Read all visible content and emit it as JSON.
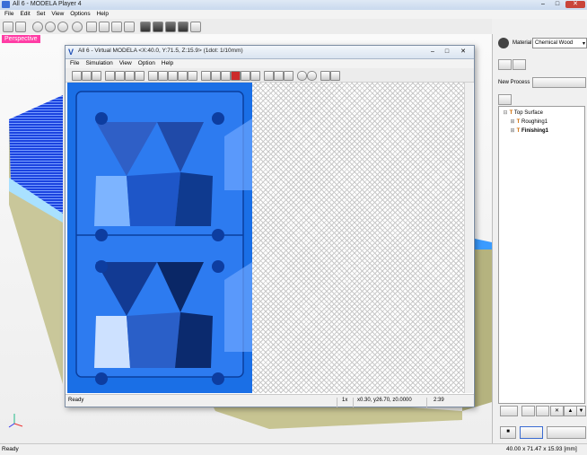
{
  "app": {
    "title": "All 6 - MODELA Player 4",
    "min_label": "–",
    "max_label": "□",
    "close_label": "✕"
  },
  "menu": [
    "File",
    "Edit",
    "Set",
    "View",
    "Options",
    "Help"
  ],
  "viewport": {
    "mode_label": "Perspective"
  },
  "right_panel": {
    "material_label": "Material",
    "material_value": "Chemical Wood",
    "new_process_label": "New Process",
    "tree": [
      {
        "label": "Top Surface",
        "level": 0,
        "expander": "⊟"
      },
      {
        "label": "Roughing1",
        "level": 1,
        "expander": "⊞"
      },
      {
        "label": "Finishing1",
        "level": 1,
        "expander": "⊞"
      }
    ]
  },
  "status_bar": {
    "left": "Ready",
    "right": "40.00 x 71.47 x 15.93 [mm]"
  },
  "virtual_modela": {
    "title": "All 6 - Virtual MODELA <X:40.0, Y:71.5, Z:15.9> (1dot: 1/10mm)",
    "menu": [
      "File",
      "Simulation",
      "View",
      "Option",
      "Help"
    ],
    "status": {
      "ready": "Ready",
      "zoom": "1x",
      "coords": "x0.30, y26.70, z0.0000",
      "time": "2:39"
    }
  },
  "colors": {
    "accent_pink": "#ff3da5",
    "model_blue": "#1a6fe6",
    "base_olive": "#c9c79a"
  },
  "icons": [
    "new-file-icon",
    "open-folder-icon",
    "save-icon",
    "zoom-icon",
    "pan-icon",
    "rotate-icon",
    "cube-view-icon",
    "tool-icon",
    "delete-icon",
    "up-arrow-icon",
    "down-arrow-icon"
  ]
}
